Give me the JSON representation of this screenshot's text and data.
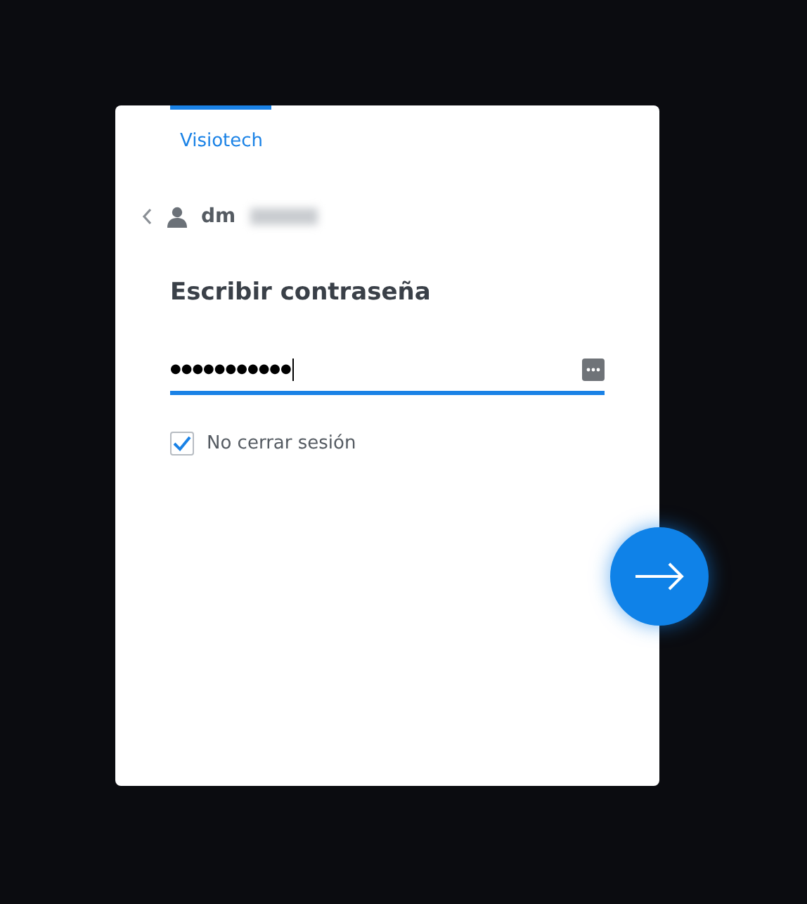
{
  "tabs": [
    {
      "label": "Visiotech",
      "selected": true
    }
  ],
  "account": {
    "username": "dm"
  },
  "title": "Escribir contraseña",
  "password": {
    "value": "●●●●●●●●●●●",
    "focused": true
  },
  "remember": {
    "label": "No cerrar sesión",
    "checked": true
  }
}
